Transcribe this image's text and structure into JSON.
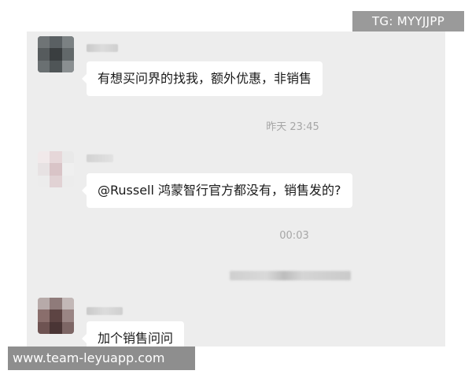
{
  "watermark": {
    "badge_text": "TG: MYYJJPP",
    "footer_text": "www.team-leyuapp.com"
  },
  "messages": [
    {
      "text": "有想买问界的找我，额外优惠，非销售"
    },
    {
      "text": "@Russell 鸿蒙智行官方都没有，销售发的?"
    },
    {
      "text": "加个销售问问"
    }
  ],
  "timestamps": {
    "first": "昨天 23:45",
    "second": "00:03"
  },
  "colors": {
    "chat_background": "#ededed",
    "bubble": "#ffffff",
    "timestamp_text": "#a6a6a6",
    "watermark_background": "#9a9a9a"
  }
}
